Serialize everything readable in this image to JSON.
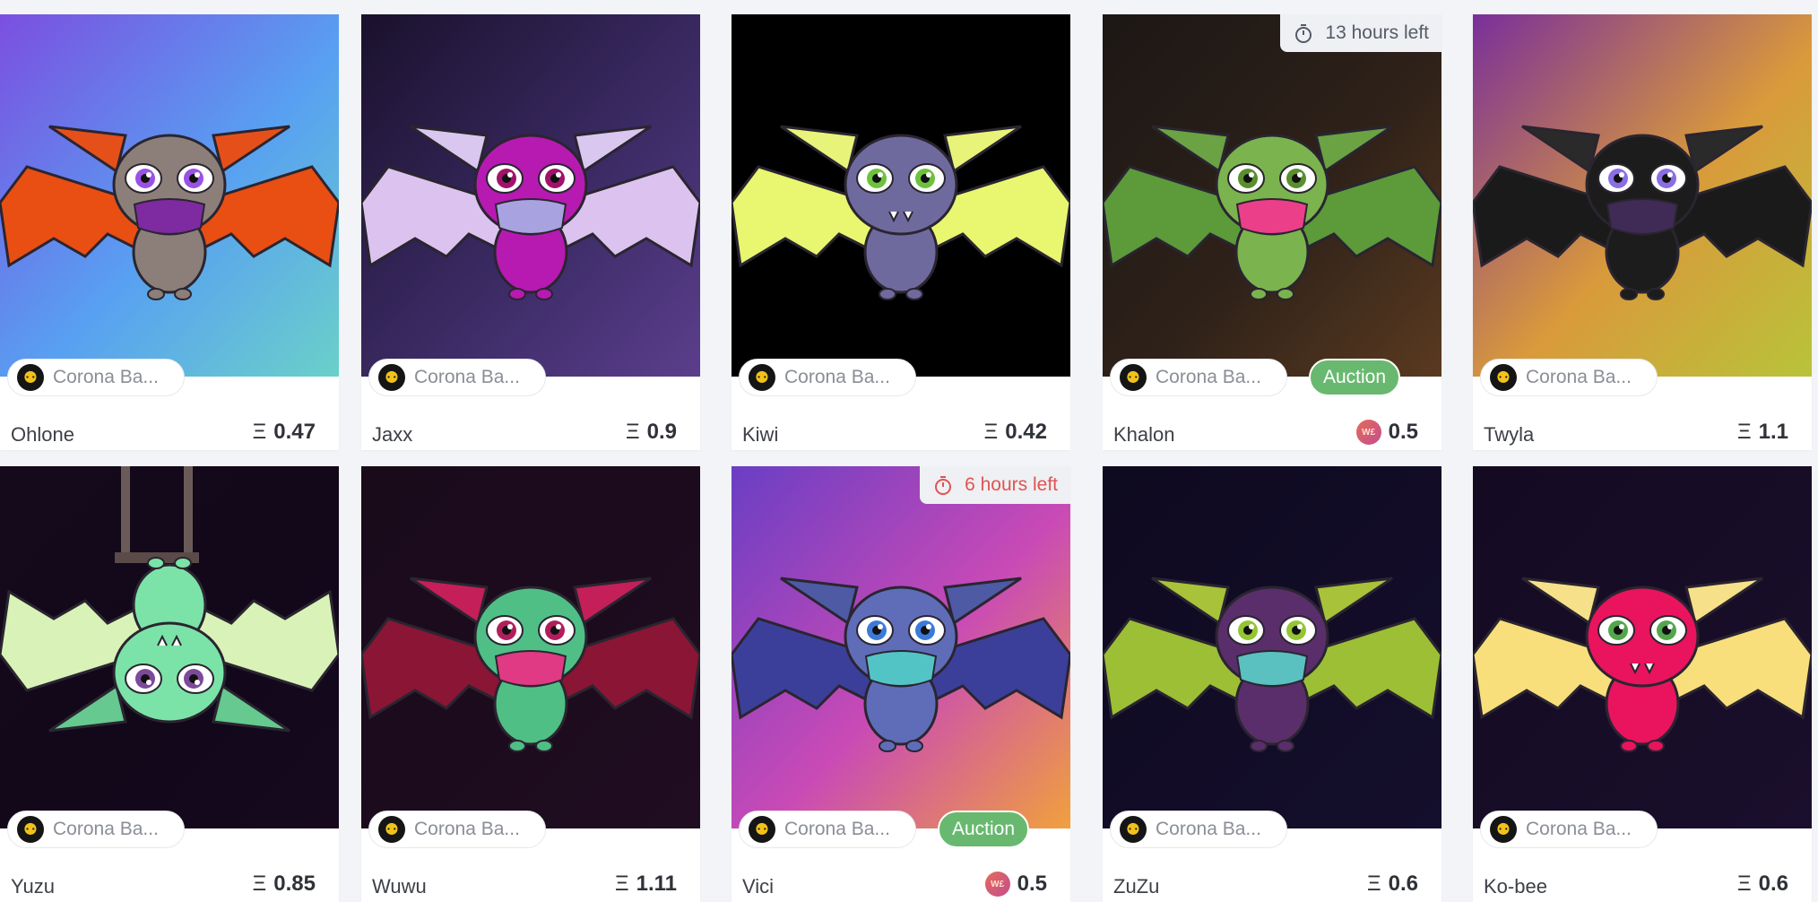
{
  "cards": [
    {
      "name": "Ohlone",
      "price": "0.47",
      "collection": "Corona Ba...",
      "auction": false,
      "timer": null,
      "bg": [
        "#7b4fe0",
        "#58a0f2",
        "#6ad0c9"
      ],
      "fur": "#8c7f7a",
      "ear": "#e5501a",
      "wing": "#e94e12",
      "eye": "#9a52e3",
      "mask": "#7e2aa0"
    },
    {
      "name": "Jaxx",
      "price": "0.9",
      "collection": "Corona Ba...",
      "auction": false,
      "timer": null,
      "bg": [
        "#1a112c",
        "#3a2a63",
        "#5b3e8c"
      ],
      "fur": "#b61ab1",
      "ear": "#d9c7f0",
      "wing": "#dcc3ef",
      "eye": "#a1126a",
      "mask": "#a9a2e0"
    },
    {
      "name": "Kiwi",
      "price": "0.42",
      "collection": "Corona Ba...",
      "auction": false,
      "timer": null,
      "bg": [
        "#000000",
        "#000000",
        "#000000"
      ],
      "fur": "#6f6a9e",
      "ear": "#e8f37a",
      "wing": "#e8f76f",
      "eye": "#6cc23c",
      "mask": null
    },
    {
      "name": "Khalon",
      "price": "0.5",
      "collection": "Corona Ba...",
      "auction": true,
      "timer": "13 hours left",
      "timer_color": "#555b66",
      "bg": [
        "#1c1715",
        "#2e2119",
        "#5a3a20"
      ],
      "fur": "#7bb34e",
      "ear": "#6aa244",
      "wing": "#5c9a3a",
      "eye": "#5a8f2d",
      "mask": "#ec3f8a"
    },
    {
      "name": "Twyla",
      "price": "1.1",
      "collection": "Corona Ba...",
      "auction": false,
      "timer": null,
      "bg": [
        "#7a2f9a",
        "#d99a3b",
        "#b8c33a"
      ],
      "fur": "#1c1c1c",
      "ear": "#2a2a2a",
      "wing": "#1a1a1a",
      "eye": "#8a6ee6",
      "mask": "#3f2b55"
    },
    {
      "name": "Yuzu",
      "price": "0.85",
      "collection": "Corona Ba...",
      "auction": false,
      "timer": null,
      "bg": [
        "#140a1c",
        "#12081a",
        "#16091e"
      ],
      "fur": "#7ce3a8",
      "ear": "#66c98f",
      "wing": "#d9f2b8",
      "eye": "#7c4a9a",
      "mask": null
    },
    {
      "name": "Wuwu",
      "price": "1.11",
      "collection": "Corona Ba...",
      "auction": false,
      "timer": null,
      "bg": [
        "#1a0b1b",
        "#1c0b1d",
        "#210d22"
      ],
      "fur": "#4fbf86",
      "ear": "#c41f59",
      "wing": "#8a1535",
      "eye": "#b21e5c",
      "mask": "#e03a84"
    },
    {
      "name": "Vici",
      "price": "0.5",
      "collection": "Corona Ba...",
      "auction": true,
      "timer": "6 hours left",
      "timer_color": "#e05353",
      "bg": [
        "#6a3ec4",
        "#c94ab6",
        "#f0a03e"
      ],
      "fur": "#5f6db8",
      "ear": "#4e5aa4",
      "wing": "#3c3f9a",
      "eye": "#3b7ad9",
      "mask": "#53c4c6"
    },
    {
      "name": "ZuZu",
      "price": "0.6",
      "collection": "Corona Ba...",
      "auction": false,
      "timer": null,
      "bg": [
        "#0e0a1f",
        "#120c27",
        "#140f2c"
      ],
      "fur": "#5a2e6a",
      "ear": "#a8c23a",
      "wing": "#9cbf36",
      "eye": "#95c532",
      "mask": "#5ac0c0"
    },
    {
      "name": "Ko-bee",
      "price": "0.6",
      "collection": "Corona Ba...",
      "auction": false,
      "timer": null,
      "bg": [
        "#140a22",
        "#170d27",
        "#1a0f2c"
      ],
      "fur": "#e9135e",
      "ear": "#f7e08a",
      "wing": "#f8df7c",
      "eye": "#53a64b",
      "mask": null
    }
  ],
  "symbols": {
    "eth": "Ξ",
    "we": "W£"
  }
}
